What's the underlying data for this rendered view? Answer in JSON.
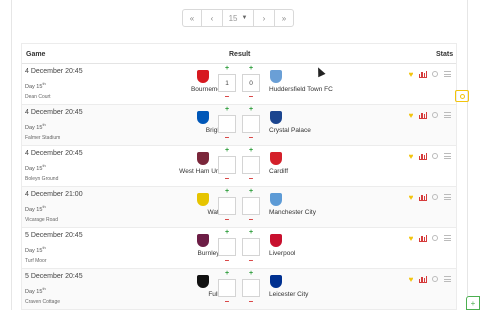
{
  "pager": {
    "first": "«",
    "prev": "‹",
    "current": "15",
    "next": "›",
    "last": "»"
  },
  "table": {
    "headers": {
      "game": "Game",
      "result": "Result",
      "stats": "Stats"
    },
    "plus": "+",
    "minus": "–",
    "matches": [
      {
        "date": "4 December 20:45",
        "day": "Day 15",
        "day_sup": "th",
        "venue": "Dean Court",
        "home": "Bournemouth",
        "away": "Huddersfield Town FC",
        "home_score": "1",
        "away_score": "0",
        "home_color": "#d71920",
        "away_color": "#6a9fd6"
      },
      {
        "date": "4 December 20:45",
        "day": "Day 15",
        "day_sup": "th",
        "venue": "Falmer Stadium",
        "home": "Brighton",
        "away": "Crystal Palace",
        "home_score": "",
        "away_score": "",
        "home_color": "#0057b8",
        "away_color": "#1b458f"
      },
      {
        "date": "4 December 20:45",
        "day": "Day 15",
        "day_sup": "th",
        "venue": "Boleyn Ground",
        "home": "West Ham United",
        "away": "Cardiff",
        "home_score": "",
        "away_score": "",
        "home_color": "#7a263a",
        "away_color": "#d4202a"
      },
      {
        "date": "4 December 21:00",
        "day": "Day 15",
        "day_sup": "th",
        "venue": "Vicarage Road",
        "home": "Watford",
        "away": "Manchester City",
        "home_score": "",
        "away_score": "",
        "home_color": "#e6c400",
        "away_color": "#5d9bd6"
      },
      {
        "date": "5 December 20:45",
        "day": "Day 15",
        "day_sup": "th",
        "venue": "Turf Moor",
        "home": "Burnley FC",
        "away": "Liverpool",
        "home_score": "",
        "away_score": "",
        "home_color": "#6c1d45",
        "away_color": "#c8102e"
      },
      {
        "date": "5 December 20:45",
        "day": "Day 15",
        "day_sup": "th",
        "venue": "Craven Cottage",
        "home": "Fulham",
        "away": "Leicester City",
        "home_score": "",
        "away_score": "",
        "home_color": "#111111",
        "away_color": "#003090"
      }
    ]
  },
  "icons": {
    "pager_caret": "caret-down-icon",
    "favorite": "heart-icon",
    "chart": "bar-chart-icon",
    "comment": "comment-icon",
    "menu": "lines-icon",
    "predict": "predict-icon",
    "corner": "plus-icon"
  },
  "corner_button": "+"
}
